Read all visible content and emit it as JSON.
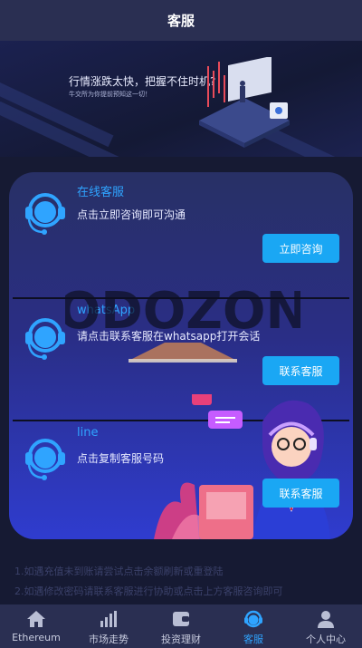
{
  "header": {
    "title": "客服"
  },
  "banner": {
    "headline": "行情涨跌太快，把握不住时机?",
    "subline": "牛交所为你提前预知这一切！"
  },
  "services": [
    {
      "title": "在线客服",
      "desc": "点击立即咨询即可沟通",
      "button": "立即咨询"
    },
    {
      "title": "whatsApp",
      "desc": "请点击联系客服在whatsapp打开会话",
      "button": "联系客服"
    },
    {
      "title": "line",
      "desc": "点击复制客服号码",
      "button": "联系客服"
    }
  ],
  "watermark": {
    "text": "ODOZON"
  },
  "notes": [
    "1.如遇充值未到账请尝试点击余额刷新或重登陆",
    "2.如遇修改密码请联系客服进行协助或点击上方客服咨询即可"
  ],
  "tabbar": {
    "tabs": [
      {
        "label": "Ethereum",
        "icon": "home-icon"
      },
      {
        "label": "市场走势",
        "icon": "bar-chart-icon"
      },
      {
        "label": "投资理财",
        "icon": "wallet-icon"
      },
      {
        "label": "客服",
        "icon": "headset-icon",
        "active": true
      },
      {
        "label": "个人中心",
        "icon": "user-icon"
      }
    ]
  },
  "colors": {
    "accent": "#1aa7f4",
    "title_blue": "#2fa4ff",
    "card_top": "#283065",
    "card_bottom": "#2f3ccf",
    "bar": "#2a2f52"
  }
}
